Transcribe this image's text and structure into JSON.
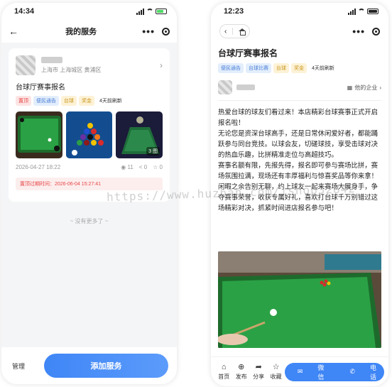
{
  "left_phone": {
    "status_time": "14:34",
    "nav_title": "我的服务",
    "card": {
      "location": "上海市 上海城区 黄浦区",
      "title": "台球厅赛事报名",
      "tags": [
        {
          "text": "置顶",
          "style": "red"
        },
        {
          "text": "便民通告",
          "style": "blue"
        },
        {
          "text": "台球",
          "style": "yellow"
        },
        {
          "text": "奖金",
          "style": "yellow"
        }
      ],
      "time_ago": "4天前刷新",
      "image_count": "3 图",
      "date": "2026-04-27 18:22",
      "views": "11",
      "shares": "0",
      "likes": "0",
      "expire_text": "置顶过期时间：2026-06-04 15:27:41"
    },
    "no_more": "~ 没有更多了 ~",
    "manage_label": "管理",
    "add_button_label": "添加服务"
  },
  "right_phone": {
    "status_time": "12:23",
    "title": "台球厅赛事报名",
    "tags": [
      {
        "text": "便民通告",
        "style": "blue"
      },
      {
        "text": "台球比赛",
        "style": "blue"
      },
      {
        "text": "台球",
        "style": "yellow"
      },
      {
        "text": "奖金",
        "style": "yellow"
      }
    ],
    "time_ago": "4天前刷新",
    "business_link": "他的企业",
    "paragraphs": [
      "热爱台球的球友们看过来！本店精彩台球赛事正式开启报名啦！",
      "无论您是资深台球高手，还是日常休闲爱好者，都能踊跃参与同台竞技。以球会友，切磋球技，享受击球对决的热血乐趣，比拼精准走位与高超技巧。",
      "赛事名额有限，先报先得，报名即可参与赛场比拼，赛场氛围拉满，现场还有丰厚福利与惊喜奖品等你来拿！",
      "闲暇之余告别无聊，约上球友一起来赛场大展身手，争夺赛事荣誉，收获专属好礼，喜欢打台球千万别错过这场精彩对决，抓紧时间进店报名参与吧！"
    ],
    "tabs": [
      {
        "label": "首页",
        "icon": "home-icon",
        "glyph": "⌂"
      },
      {
        "label": "发布",
        "icon": "plus-circle-icon",
        "glyph": "⊕"
      },
      {
        "label": "分享",
        "icon": "share-icon",
        "glyph": "➦"
      },
      {
        "label": "收藏",
        "icon": "star-icon",
        "glyph": "☆"
      }
    ],
    "wechat_label": "微信",
    "phone_label": "电话"
  },
  "watermark": "https://www.huzhan.com/ishop32842",
  "colors": {
    "accent_blue": "#3f86f6",
    "tag_red": "#e64545",
    "tag_blue": "#4a7fd6",
    "tag_yellow": "#c9961f",
    "table_green": "#1f8f3a"
  }
}
